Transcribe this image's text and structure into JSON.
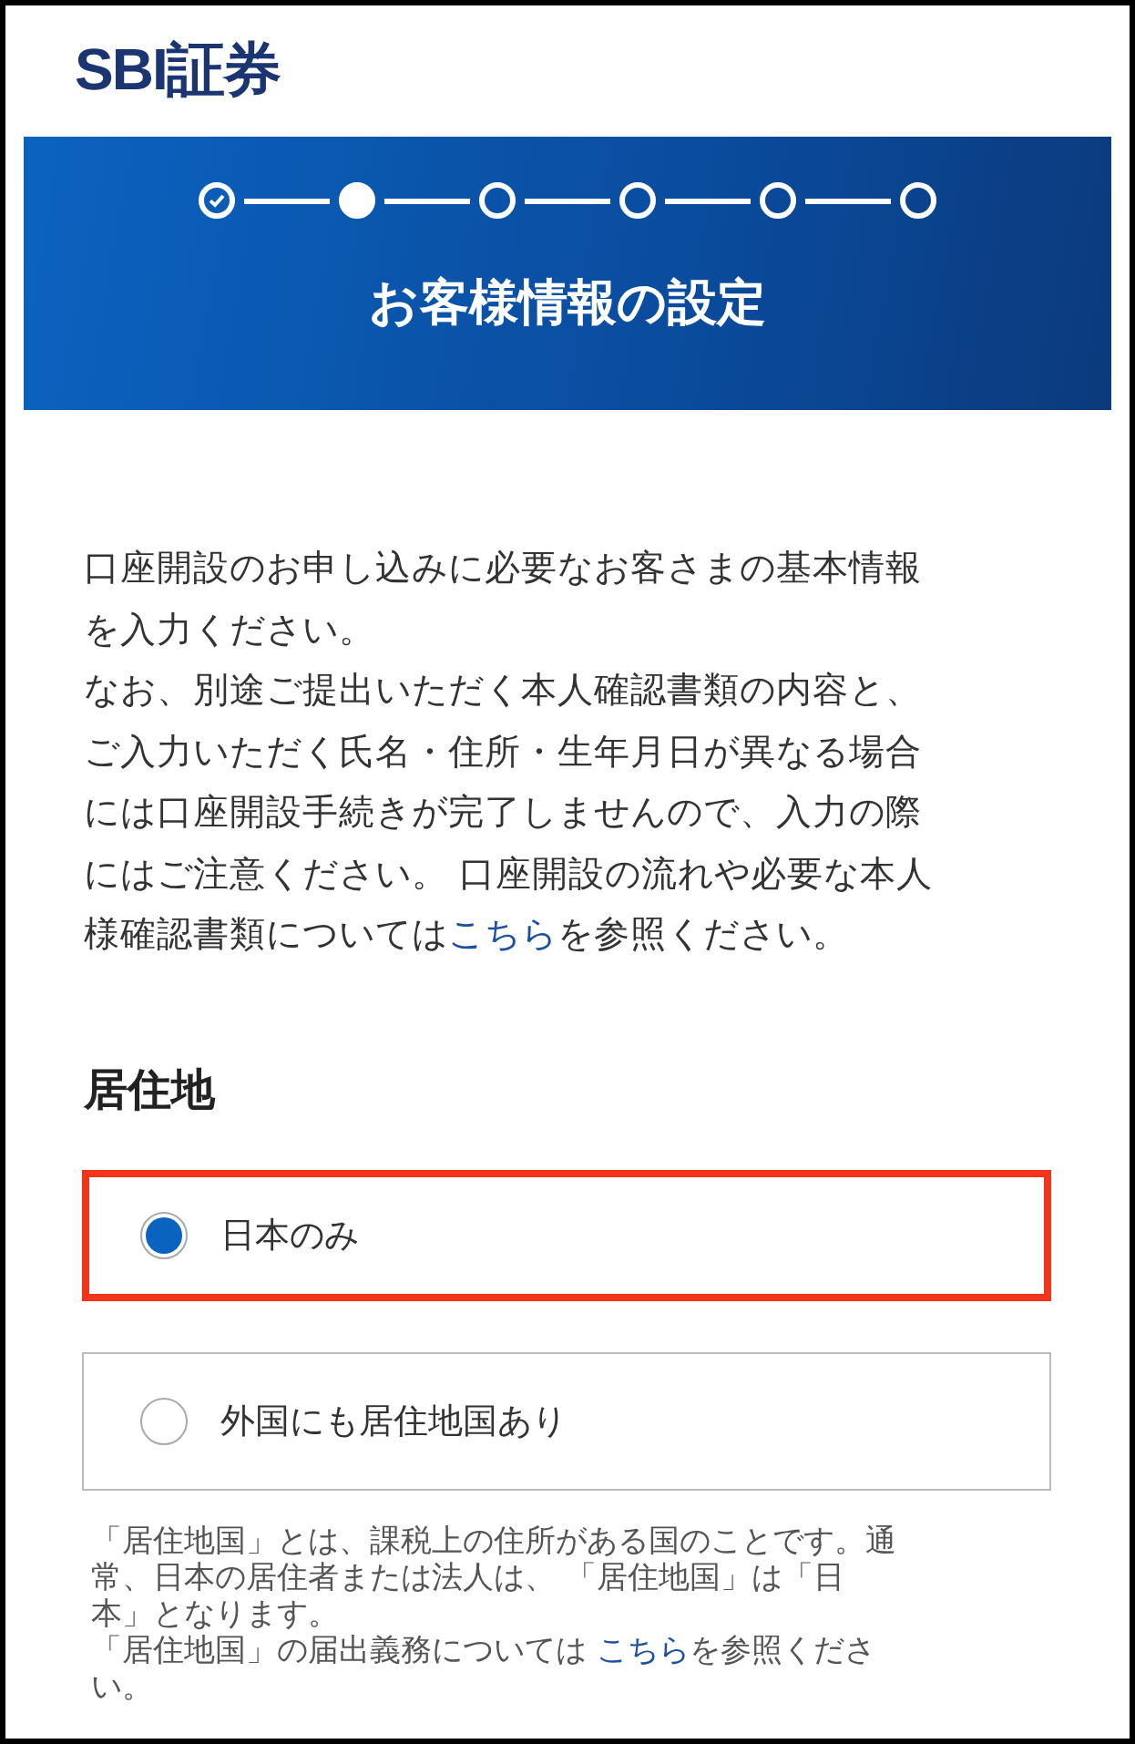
{
  "logo": "SBI証券",
  "steps": [
    {
      "kind": "done"
    },
    {
      "kind": "current"
    },
    {
      "kind": "todo"
    },
    {
      "kind": "todo"
    },
    {
      "kind": "todo"
    },
    {
      "kind": "todo"
    }
  ],
  "banner_title": "お客様情報の設定",
  "intro_lead": "口座開設のお申し込みに必要なお客さまの基本情報を入力ください。",
  "intro": {
    "text": "なお、別途ご提出いただく本人確認書類の内容と、ご入力いただく氏名・住所・生年月日が異なる場合には口座開設手続きが完了しませんので、入力の際にはご注意ください。 口座開設の流れや必要な本人様確認書類については",
    "link": "こちら",
    "text_after": "を参照ください。"
  },
  "section_title": "居住地",
  "options": [
    {
      "label": "日本のみ",
      "selected": true,
      "highlighted": true
    },
    {
      "label": "外国にも居住地国あり",
      "selected": false,
      "highlighted": false
    }
  ],
  "note_lead": "「居住地国」とは、課税上の住所がある国のことです。通常、日本の居住者または法人は、 「居住地国」は「日本」となります。",
  "note": {
    "text": "「居住地国」の届出義務については ",
    "link": "こちら",
    "text_after": "を参照ください。"
  }
}
